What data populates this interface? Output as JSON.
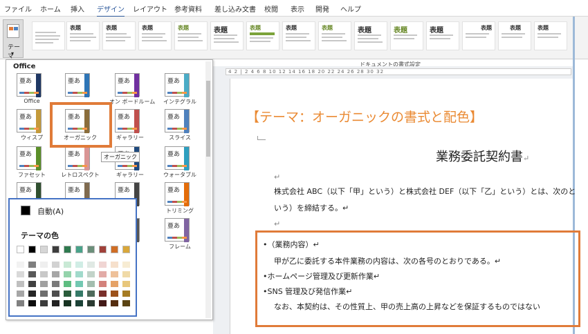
{
  "ribbon": {
    "tabs": [
      "ファイル",
      "ホーム",
      "挿入",
      "デザイン",
      "レイアウト",
      "参考資料",
      "差し込み文書",
      "校閲",
      "表示",
      "開発",
      "ヘルプ"
    ],
    "active_tab": "デザイン",
    "theme_button_label": "テーマ",
    "doc_format_label": "ドキュメントの書式設定",
    "style_titles": [
      "",
      "表題",
      "表題",
      "表題",
      "表題",
      "表題",
      "表題",
      "表題",
      "表題",
      "表題",
      "表題",
      "表題",
      "表題",
      "表題",
      "表題"
    ]
  },
  "gallery": {
    "header": "Office",
    "tile_glyph": "亜あ",
    "themes": [
      {
        "name": "Office",
        "color": "#1f3864"
      },
      {
        "name": "",
        "color": "#2e75b6"
      },
      {
        "name": "オン ボードルーム",
        "color": "#7030a0"
      },
      {
        "name": "インテグラル",
        "color": "#4bacc6"
      },
      {
        "name": "ウィスプ",
        "color": "#c49a3b"
      },
      {
        "name": "オーガニック",
        "color": "#8a6d3b"
      },
      {
        "name": "ギャラリー",
        "color": "#c0504d"
      },
      {
        "name": "スライス",
        "color": "#4f81bd"
      },
      {
        "name": "ファセット",
        "color": "#5b8f29"
      },
      {
        "name": "レトロスペクト",
        "color": "#d99594"
      },
      {
        "name": "ギャラリー",
        "color": "#1f497d"
      },
      {
        "name": "ウォータブル",
        "color": "#2e9fbf"
      },
      {
        "name": "",
        "color": "#2f4f2f"
      },
      {
        "name": "",
        "color": "#7f6a4f"
      },
      {
        "name": "",
        "color": "#444444"
      },
      {
        "name": "トリミング",
        "color": "#e36c09"
      },
      {
        "name": "",
        "color": "#999999"
      },
      {
        "name": "",
        "color": "#666666"
      },
      {
        "name": "",
        "color": "#555555"
      },
      {
        "name": "フレーム",
        "color": "#8064a2"
      }
    ],
    "tooltip": "オーガニック"
  },
  "color_panel": {
    "auto_label": "自動(A)",
    "heading": "テーマの色",
    "theme_colors": [
      "#ffffff",
      "#000000",
      "#d6d6d6",
      "#3d3d3d",
      "#2f7a4f",
      "#4aa38a",
      "#6b8f7a",
      "#a0413a",
      "#d06e25",
      "#d9a73a"
    ],
    "shade_columns": [
      [
        "#f2f2f2",
        "#d9d9d9",
        "#bfbfbf",
        "#a6a6a6",
        "#808080"
      ],
      [
        "#7f7f7f",
        "#595959",
        "#404040",
        "#262626",
        "#0d0d0d"
      ],
      [
        "#efefef",
        "#c8c8c8",
        "#a0a0a0",
        "#6e6e6e",
        "#3c3c3c"
      ],
      [
        "#d2d2d2",
        "#a6a6a6",
        "#7a7a7a",
        "#4e4e4e",
        "#222222"
      ],
      [
        "#c9e9d5",
        "#94d3ab",
        "#5ebd81",
        "#2a5c3b",
        "#173322"
      ],
      [
        "#d0ede5",
        "#a1dacb",
        "#72c8b1",
        "#357a67",
        "#1c4237"
      ],
      [
        "#e0e9e4",
        "#c2d3c9",
        "#a3bdae",
        "#4f6b5b",
        "#2b3a31"
      ],
      [
        "#f0d5d3",
        "#e2aba7",
        "#d3817b",
        "#7a302b",
        "#431a17"
      ],
      [
        "#f6e0cc",
        "#eec19a",
        "#e5a267",
        "#9c521b",
        "#552d0f"
      ],
      [
        "#f7ecd3",
        "#f0daa7",
        "#e8c77b",
        "#a67c23",
        "#5b4413"
      ]
    ]
  },
  "document": {
    "ruler": "4  2  |  2  4  6  8  10  12  14  16  18  20  22  24  26  28  30  32",
    "heading": "【テーマ：オーガニックの書式と配色】",
    "title": "業務委託契約書",
    "paragraph_mark": "↵",
    "para_1": "株式会社 ABC（以下「甲」という）と株式会社 DEF（以下「乙」という）とは、次のと",
    "para_1b": "いう）を締結する。↵",
    "lines": [
      "•（業務内容）↵",
      "甲が乙に委託する本件業務の内容は、次の各号のとおりである。↵",
      "•ホームページ管理及び更新作業↵",
      "•SNS 管理及び発信作業↵",
      "なお、本契約は、その性質上、甲の売上高の上昇などを保証するものではない"
    ]
  },
  "colors": {
    "highlight": "#e07b39",
    "panel_border": "#4472c4",
    "heading_text": "#ea8a33"
  }
}
